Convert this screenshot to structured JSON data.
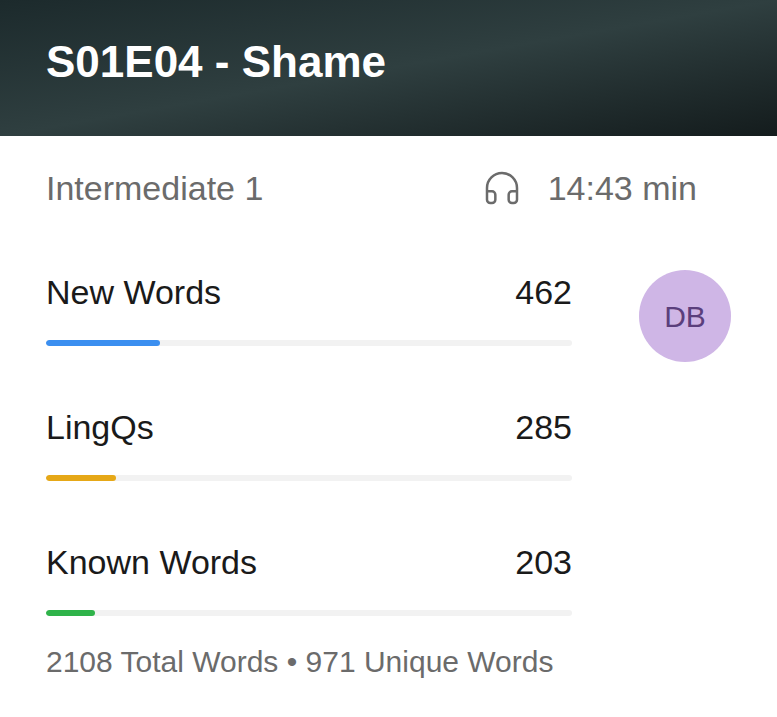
{
  "episode": {
    "title": "S01E04 - Shame",
    "level": "Intermediate 1",
    "duration": "14:43 min"
  },
  "stats": [
    {
      "label": "New Words",
      "count": "462",
      "level": 0.216,
      "color": "#3b8ff0"
    },
    {
      "label": "LingQs",
      "count": "285",
      "level": 0.133,
      "color": "#e6a817"
    },
    {
      "label": "Known Words",
      "count": "203",
      "level": 0.094,
      "color": "#2fb34a"
    }
  ],
  "avatar": {
    "initials": "DB"
  },
  "footer": {
    "summary": "2108 Total Words • 971 Unique Words"
  }
}
